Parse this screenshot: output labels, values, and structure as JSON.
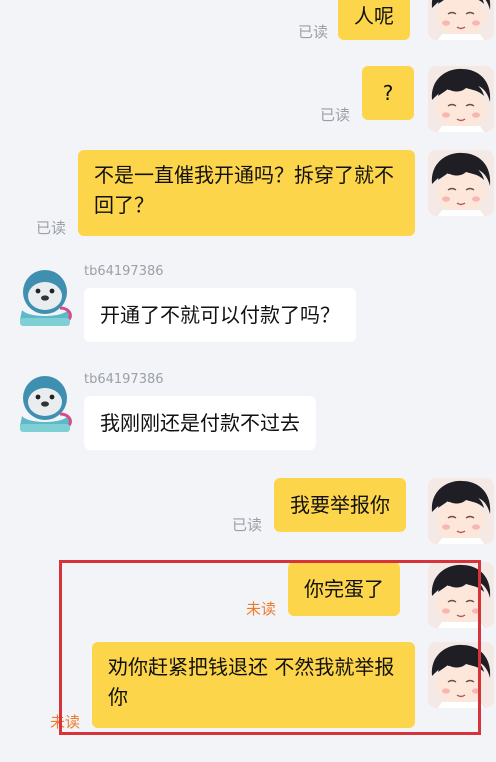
{
  "messages": [
    {
      "id": "m1",
      "sender": "me",
      "text": "人呢",
      "status": "已读"
    },
    {
      "id": "m2",
      "sender": "me",
      "text": "?",
      "status": "已读"
    },
    {
      "id": "m3",
      "sender": "me",
      "text": "不是一直催我开通吗？拆穿了就不回了？",
      "status": "已读"
    },
    {
      "id": "m4",
      "sender": "other",
      "username": "tb64197386",
      "text": "开通了不就可以付款了吗？"
    },
    {
      "id": "m5",
      "sender": "other",
      "username": "tb64197386",
      "text": "我刚刚还是付款不过去"
    },
    {
      "id": "m6",
      "sender": "me",
      "text": "我要举报你",
      "status": "已读"
    },
    {
      "id": "m7",
      "sender": "me",
      "text": "你完蛋了",
      "status": "未读"
    },
    {
      "id": "m8",
      "sender": "me",
      "text": "劝你赶紧把钱退还 不然我就举报你",
      "status": "未读"
    }
  ],
  "colors": {
    "background": "#f3f4f8",
    "my_bubble": "#fdd54a",
    "their_bubble": "#ffffff",
    "read_status": "#9aa0a8",
    "unread_status": "#f07a2a",
    "highlight_border": "#d6333a"
  },
  "icons": {
    "my_avatar": "cartoon-girl-avatar",
    "their_avatar": "seal-avatar"
  }
}
